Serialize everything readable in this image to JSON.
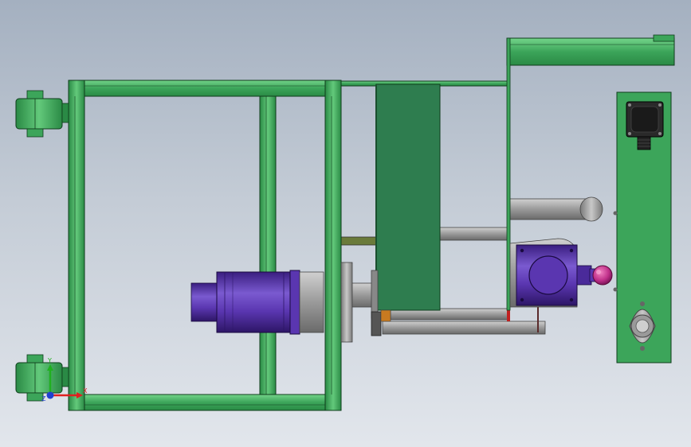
{
  "viewport": {
    "kind": "cad-3d-assembly-view",
    "background_top": "#a4b0c0",
    "background_bottom": "#e2e6ec"
  },
  "colors": {
    "frame_green": "#3ca55a",
    "frame_green_light": "#63c97b",
    "frame_outline": "#0f3d1c",
    "plate_dark_green": "#2e7d4f",
    "motor_purple": "#4a2a9a",
    "motor_purple_light": "#7a5ad0",
    "gray_metal": "#a7a7a7",
    "gray_dark": "#6f6f6f",
    "knob_magenta": "#c0308a"
  },
  "triad": {
    "x_label": "X",
    "y_label": "Y",
    "z_label": "Z",
    "x_color": "#e02020",
    "y_color": "#20b020",
    "z_color": "#2040d0"
  },
  "parts": [
    "caster-wheel-top",
    "caster-wheel-bottom",
    "left-frame",
    "connecting-rail",
    "dark-green-plate",
    "servo-motor",
    "gear-coupling",
    "guide-rods",
    "right-frame",
    "side-plate",
    "stepper-motor-small",
    "pillow-block-bearing",
    "gearbox",
    "handwheel-knob"
  ]
}
